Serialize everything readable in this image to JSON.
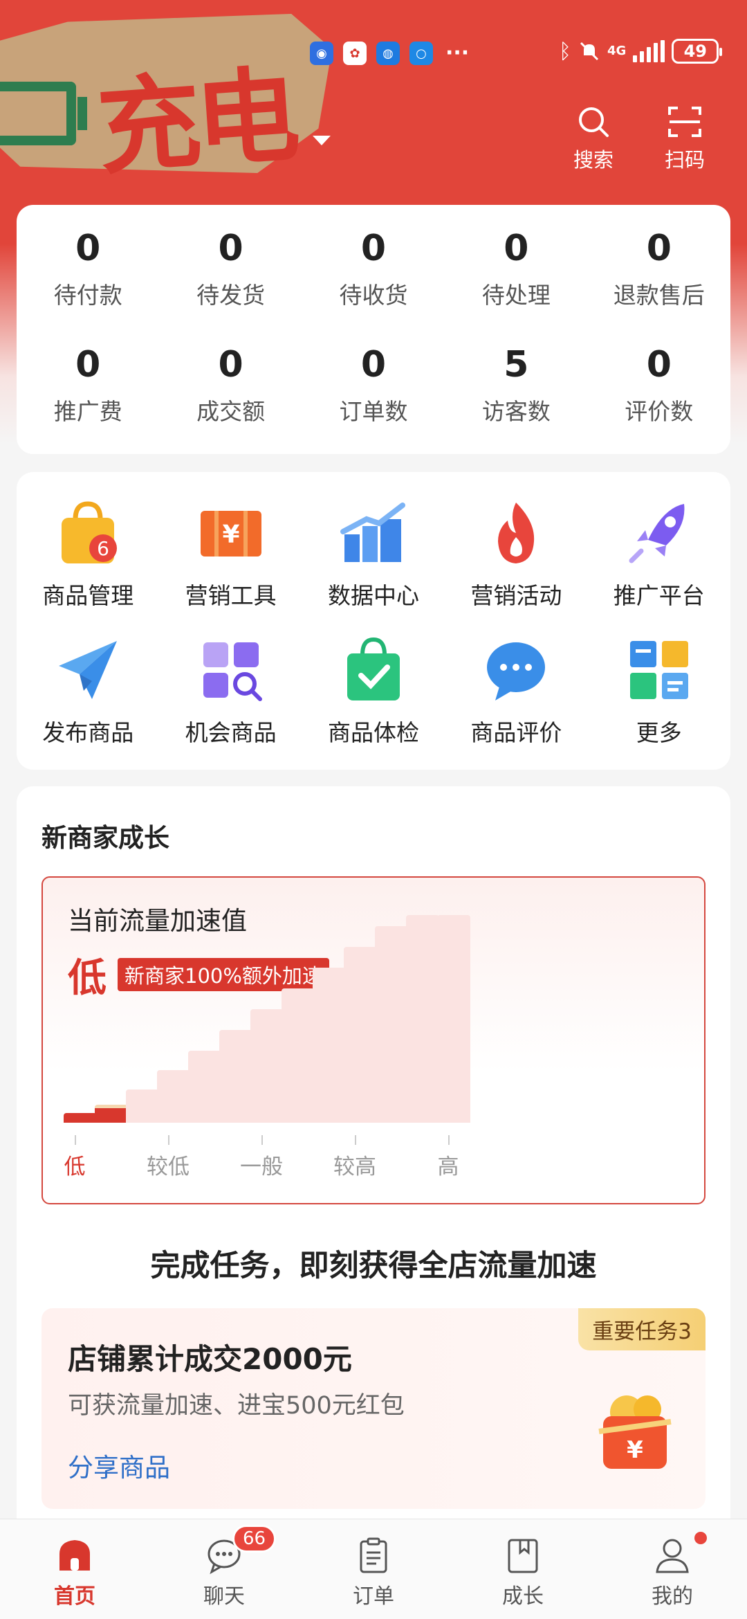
{
  "app": {
    "accent": "#e1453a",
    "banner_text": "充电"
  },
  "status_bar": {
    "battery": "49",
    "network": "4G"
  },
  "header": {
    "search_label": "搜索",
    "scan_label": "扫码"
  },
  "stats": [
    {
      "value": "0",
      "label": "待付款"
    },
    {
      "value": "0",
      "label": "待发货"
    },
    {
      "value": "0",
      "label": "待收货"
    },
    {
      "value": "0",
      "label": "待处理"
    },
    {
      "value": "0",
      "label": "退款售后"
    },
    {
      "value": "0",
      "label": "推广费"
    },
    {
      "value": "0",
      "label": "成交额"
    },
    {
      "value": "0",
      "label": "订单数"
    },
    {
      "value": "5",
      "label": "访客数"
    },
    {
      "value": "0",
      "label": "评价数"
    }
  ],
  "tools": [
    {
      "label": "商品管理",
      "icon": "shopping-bag-icon",
      "badge": "6"
    },
    {
      "label": "营销工具",
      "icon": "coupon-icon"
    },
    {
      "label": "数据中心",
      "icon": "bar-chart-icon"
    },
    {
      "label": "营销活动",
      "icon": "flame-icon"
    },
    {
      "label": "推广平台",
      "icon": "rocket-icon"
    },
    {
      "label": "发布商品",
      "icon": "paper-plane-icon"
    },
    {
      "label": "机会商品",
      "icon": "grid-search-icon"
    },
    {
      "label": "商品体检",
      "icon": "check-bag-icon"
    },
    {
      "label": "商品评价",
      "icon": "chat-bubble-icon"
    },
    {
      "label": "更多",
      "icon": "more-apps-icon"
    }
  ],
  "growth": {
    "title": "新商家成长",
    "speed_title": "当前流量加速值",
    "speed_level": "低",
    "speed_badge": "新商家100%额外加速",
    "level_count": 13,
    "current_levels": 2,
    "axis_labels": [
      "低",
      "较低",
      "一般",
      "较高",
      "高"
    ]
  },
  "tasks": {
    "heading": "完成任务，即刻获得全店流量加速",
    "items": [
      {
        "tag": "重要任务3",
        "title": "店铺累计成交2000元",
        "desc": "可获流量加速、进宝500元红包",
        "link": "分享商品"
      }
    ]
  },
  "tabbar": [
    {
      "label": "首页",
      "icon": "home-icon",
      "active": true
    },
    {
      "label": "聊天",
      "icon": "chat-icon",
      "badge": "66"
    },
    {
      "label": "订单",
      "icon": "order-list-icon"
    },
    {
      "label": "成长",
      "icon": "growth-book-icon"
    },
    {
      "label": "我的",
      "icon": "user-icon",
      "dot": true
    }
  ]
}
